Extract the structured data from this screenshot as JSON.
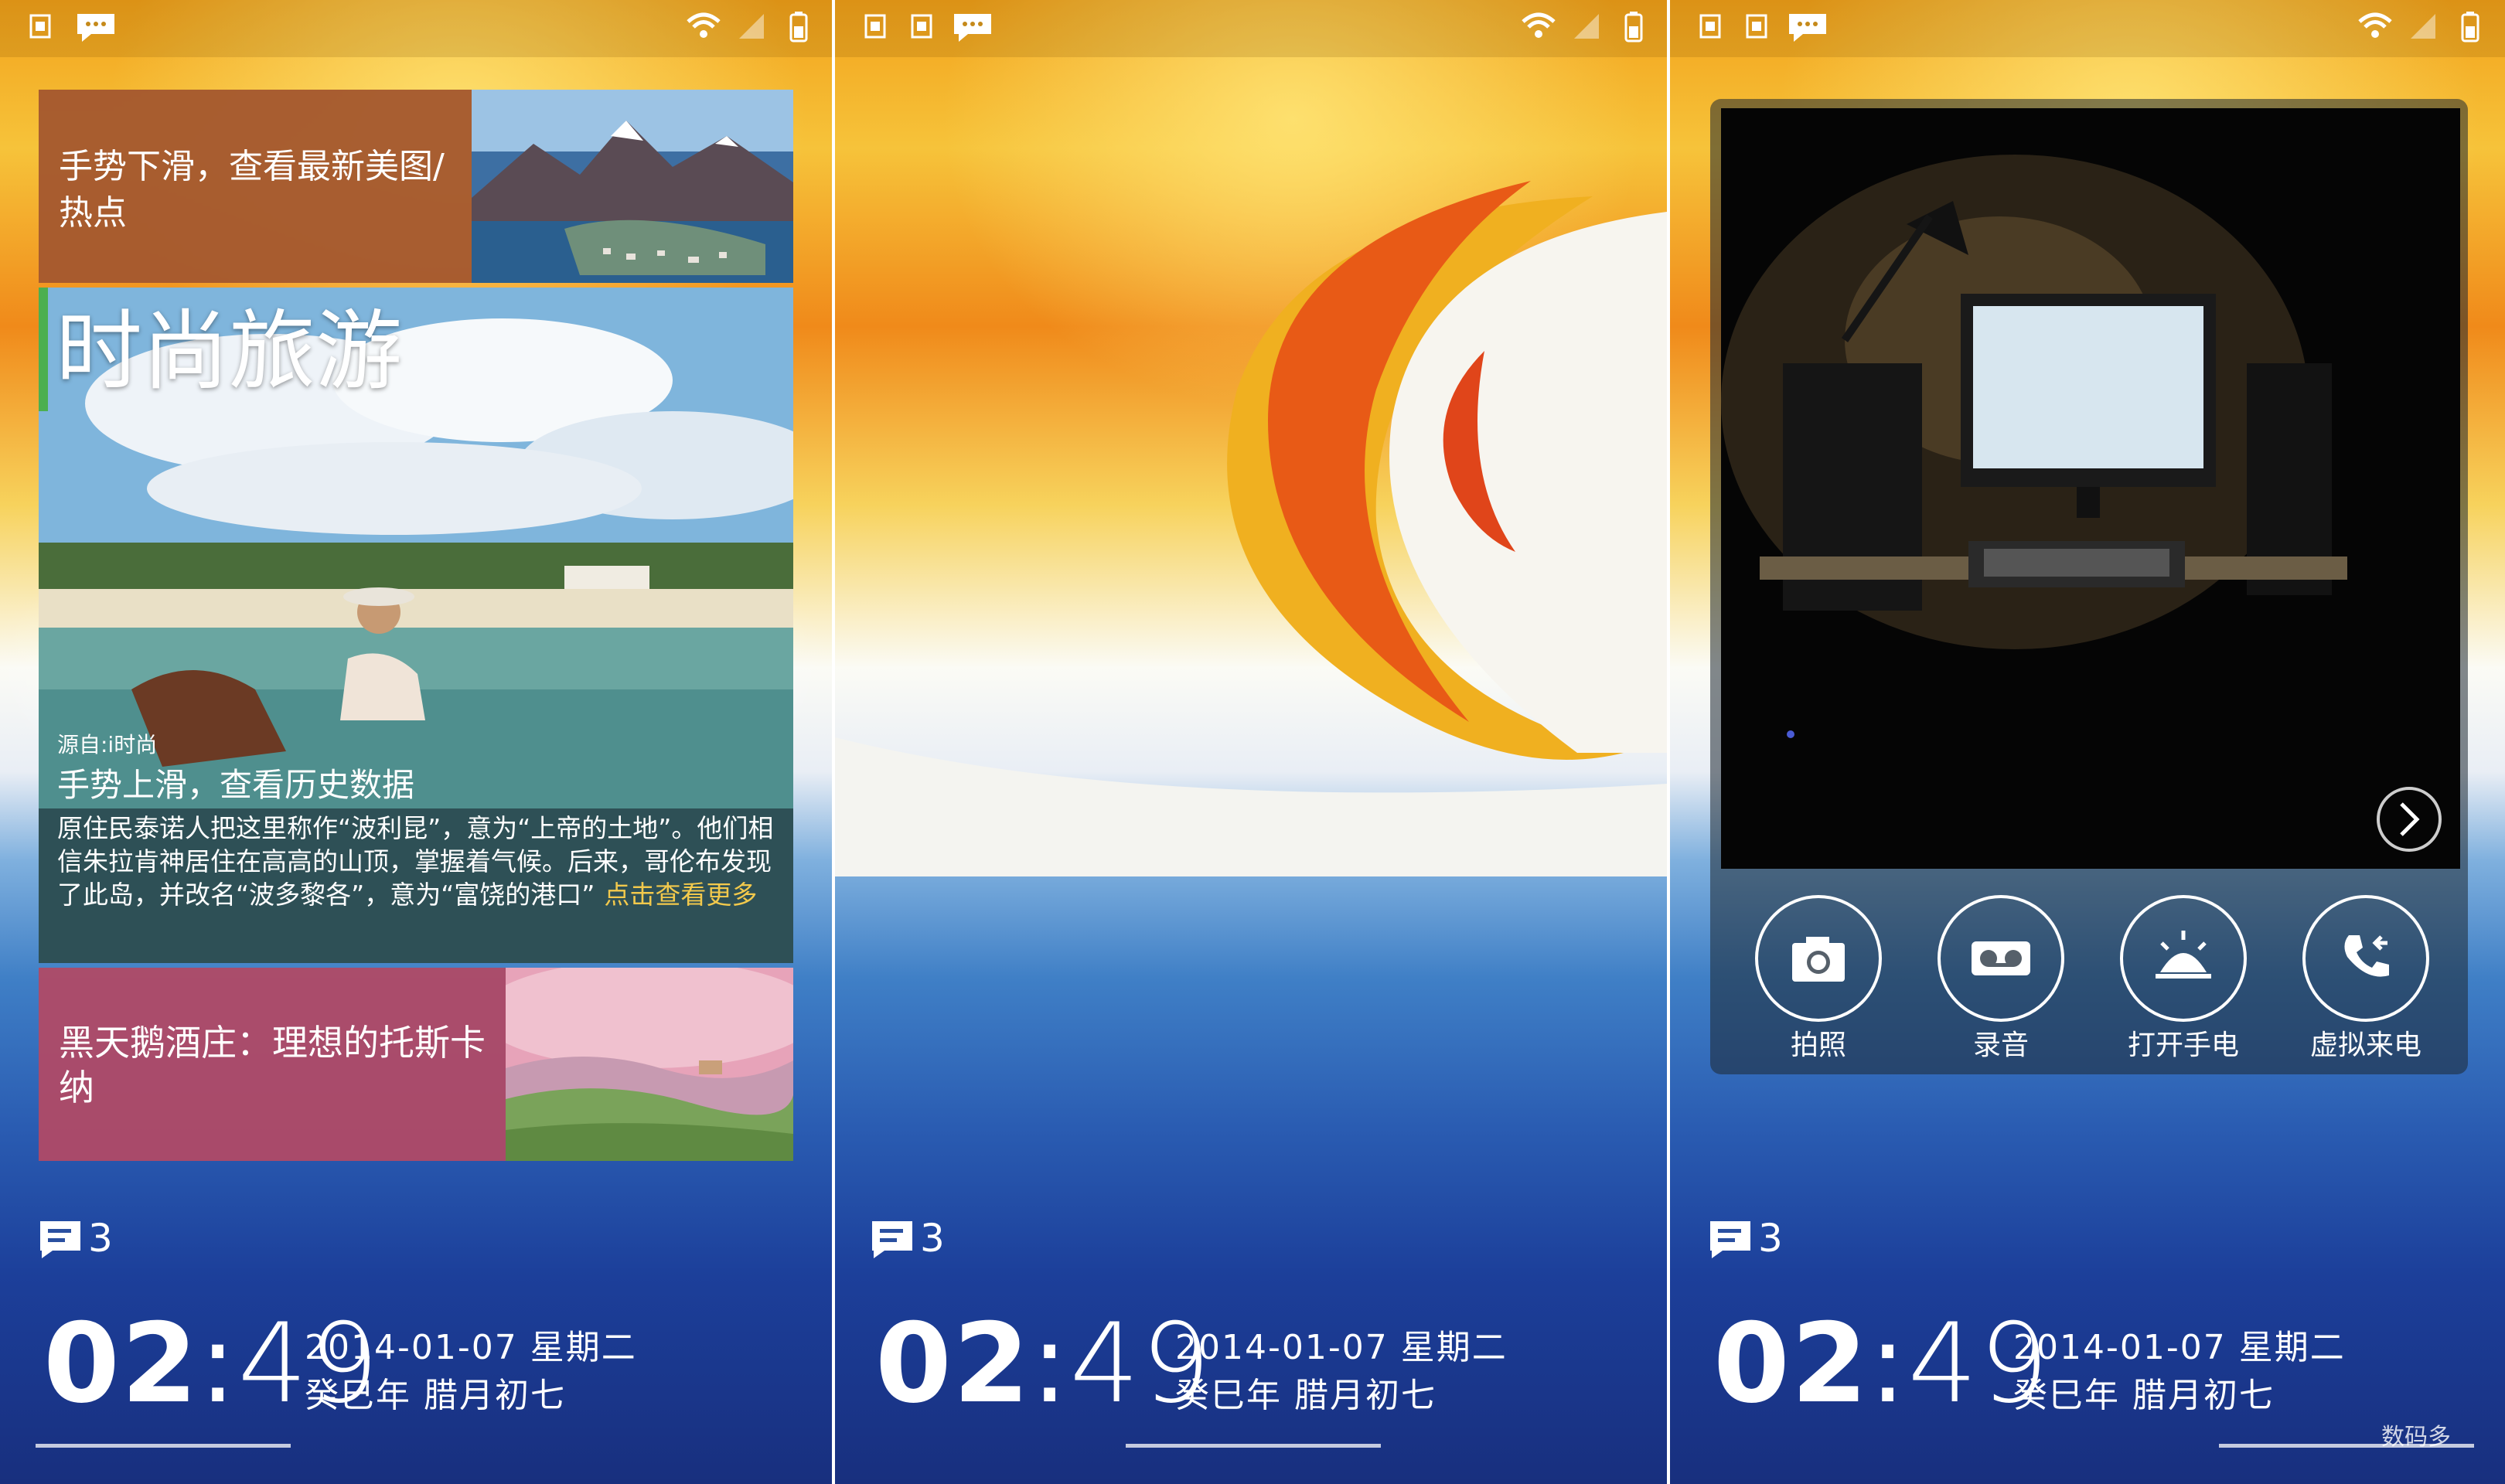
{
  "screens": [
    {
      "cards": {
        "top": {
          "title": "手势下滑，查看最新美图/热点"
        },
        "main": {
          "title": "时尚旅游",
          "source": "源自:i时尚",
          "headline": "手势上滑，查看历史数据",
          "body": "原住民泰诺人把这里称作“波利昆”，意为“上帝的土地”。他们相信朱拉肯神居住在高高的山顶，掌握着气候。后来，哥伦布发现了此岛，并改名“波多黎各”，意为“富饶的港口”",
          "more": "点击查看更多"
        },
        "bottom": {
          "title": "黑天鹅酒庄：理想的托斯卡纳"
        }
      },
      "messages_count": "3",
      "clock": {
        "hour": "02",
        "minute": "49"
      },
      "date_line": "2014-01-07 星期二",
      "lunar_line": "癸巳年 腊月初七"
    },
    {
      "messages_count": "3",
      "clock": {
        "hour": "02",
        "minute": "49"
      },
      "date_line": "2014-01-07 星期二",
      "lunar_line": "癸巳年 腊月初七"
    },
    {
      "tools": [
        {
          "label": "拍照",
          "icon": "camera-icon"
        },
        {
          "label": "录音",
          "icon": "recorder-icon"
        },
        {
          "label": "打开手电",
          "icon": "flashlight-icon"
        },
        {
          "label": "虚拟来电",
          "icon": "fake-call-icon"
        }
      ],
      "messages_count": "3",
      "clock": {
        "hour": "02",
        "minute": "49"
      },
      "date_line": "2014-01-07 星期二",
      "lunar_line": "癸巳年 腊月初七"
    }
  ],
  "watermark": "数码多"
}
